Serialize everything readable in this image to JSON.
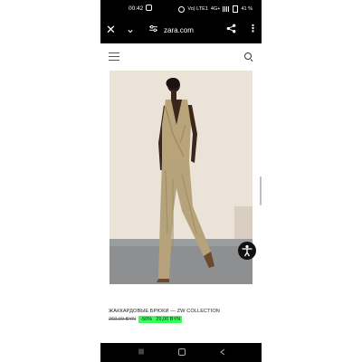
{
  "status_bar": {
    "time": "00:42",
    "network": "Vo) LTE1",
    "signal_label": "4G+",
    "battery": "41 %"
  },
  "browser": {
    "url": "zara.com",
    "icons": [
      "close-icon",
      "chevron-down-icon",
      "tune-icon",
      "share-icon",
      "more-vertical-icon"
    ]
  },
  "site_header": {
    "icons": [
      "menu-icon",
      "search-icon"
    ]
  },
  "product": {
    "image": "model-in-jacquard-jumpsuit",
    "name": "ЖАККАРДОВЫЕ БРЮКИ — ZW COLLECTION",
    "old_price": "269,00 BYN",
    "discount": "-50%",
    "new_price": "29,00 BYN"
  },
  "colors": {
    "bars": "#000000",
    "discount_highlight": "#39ff5a",
    "image_background": "#ebe3d8"
  },
  "nav_bar": {
    "icons": [
      "recent-apps-icon",
      "home-icon",
      "back-icon"
    ]
  }
}
